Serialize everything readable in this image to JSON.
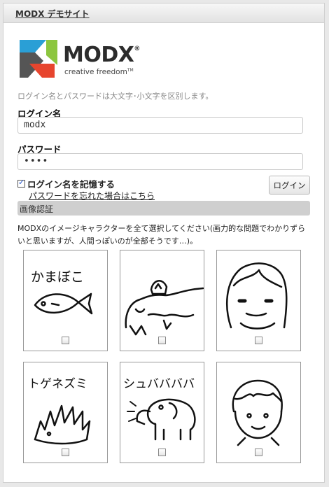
{
  "header": {
    "site_title": "MODX デモサイト"
  },
  "logo": {
    "wordmark": "MODX",
    "registered": "®",
    "tagline": "creative freedom",
    "trademark": "TM",
    "colors": [
      "#2a9fd6",
      "#e7452e",
      "#8cc63f",
      "#555555"
    ]
  },
  "login": {
    "case_note": "ログイン名とパスワードは大文字･小文字を区別します。",
    "username_label": "ログイン名",
    "username_value": "modx",
    "password_label": "パスワード",
    "password_value": "••••",
    "remember_label": "ログイン名を記憶する",
    "remember_checked": true,
    "forgot_link": "パスワードを忘れた場合はこちら",
    "login_button": "ログイン"
  },
  "captcha": {
    "section_title": "画像認証",
    "instructions": "MODXのイメージキャラクターを全て選択してください(画力的な問題でわかりずらいと思いますが、人間っぽいのが全部そうです…)。",
    "tiles": [
      {
        "caption": "かまぼこ",
        "subject": "fish",
        "checked": false
      },
      {
        "caption": "",
        "subject": "animal-with-rider",
        "checked": false
      },
      {
        "caption": "",
        "subject": "girl",
        "checked": false
      },
      {
        "caption": "トゲネズミ",
        "subject": "hedgehog",
        "checked": false
      },
      {
        "caption": "シュババババ",
        "subject": "elephant",
        "checked": false
      },
      {
        "caption": "",
        "subject": "boy",
        "checked": false
      }
    ]
  }
}
